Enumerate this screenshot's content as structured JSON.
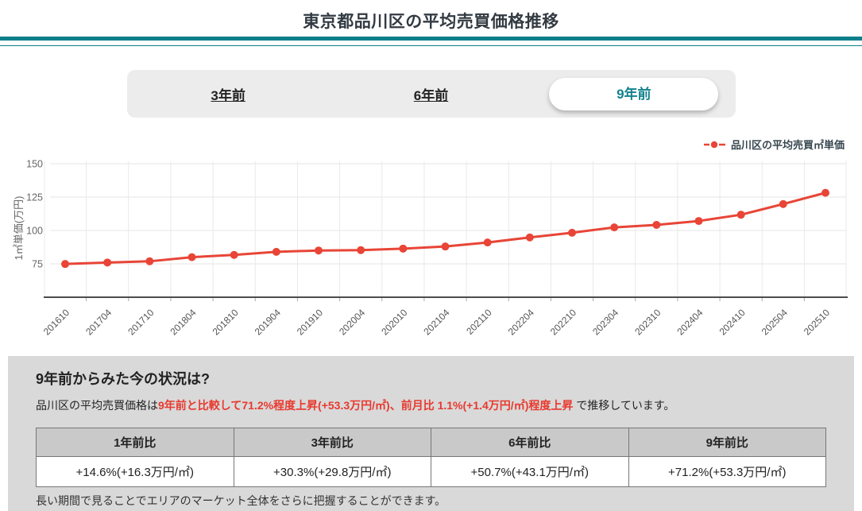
{
  "page": {
    "title": "東京都品川区の平均売買価格推移"
  },
  "colors": {
    "accent_teal": "#0d7f8b",
    "line_red": "#e84537",
    "highlight_red": "#e8392e"
  },
  "tabs": [
    {
      "label": "3年前",
      "selected": false
    },
    {
      "label": "6年前",
      "selected": false
    },
    {
      "label": "9年前",
      "selected": true
    }
  ],
  "chart_data": {
    "type": "line",
    "x": [
      "201610",
      "201704",
      "201710",
      "201804",
      "201810",
      "201904",
      "201910",
      "202004",
      "202010",
      "202104",
      "202110",
      "202204",
      "202210",
      "202304",
      "202310",
      "202404",
      "202410",
      "202504",
      "202510"
    ],
    "series": [
      {
        "name": "品川区の平均売買㎡単価",
        "values": [
          74.9,
          76.0,
          76.9,
          80.0,
          81.7,
          84.0,
          85.0,
          85.3,
          86.4,
          88.0,
          91.0,
          94.8,
          98.3,
          102.3,
          104.2,
          107.1,
          111.8,
          119.8,
          128.2
        ]
      }
    ],
    "ylabel": "1㎡単価(万円)",
    "xlabel": "",
    "yticks": [
      75,
      100,
      125,
      150
    ],
    "ylim": [
      50,
      150
    ],
    "grid": true,
    "legend_position": "top-right",
    "line_color": "#e84537"
  },
  "summary": {
    "heading": "9年前からみた今の状況は?",
    "text_prefix": "品川区の平均売買価格は",
    "text_highlight": "9年前と比較して71.2%程度上昇(+53.3万円/㎡)、前月比 1.1%(+1.4万円/㎡)程度上昇",
    "text_suffix": " で推移しています。",
    "note": "長い期間で見ることでエリアのマーケット全体をさらに把握することができます。"
  },
  "comparison_table": {
    "headers": [
      "1年前比",
      "3年前比",
      "6年前比",
      "9年前比"
    ],
    "values": [
      "+14.6%(+16.3万円/㎡)",
      "+30.3%(+29.8万円/㎡)",
      "+50.7%(+43.1万円/㎡)",
      "+71.2%(+53.3万円/㎡)"
    ]
  }
}
